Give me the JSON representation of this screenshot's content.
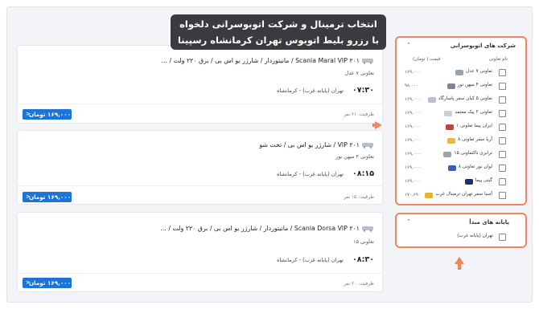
{
  "banner": {
    "line1": "انتخاب ترمینال و شرکت اتوبوسرانی دلخواه",
    "line2": "با رزرو بلیط اتوبوس تهران کرمانشاه رسپینا"
  },
  "trips": [
    {
      "title": "۲۰۱ Scania Maral VIP / مانیتوردار / شارژر یو اس بی / برق ۲۲۰ ولت / ...",
      "company": "تعاونی ۷ عدل",
      "time": "۰۷:۳۰",
      "route": "تهران (پایانه غرب) - کرمانشاه",
      "capacity": "ظرفیت: ۲۱ نفر",
      "price": "۱۶۹,۰۰۰ تومان"
    },
    {
      "title": "۲۰۱ VIP / شارژر یو اس بی / تخت شو",
      "company": "تعاونی ۴ میهن نور",
      "time": "۰۸:۱۵",
      "route": "تهران (پایانه غرب) - کرمانشاه",
      "capacity": "ظرفیت: ۱۵ نفر",
      "price": "۱۶۹,۰۰۰ تومان"
    },
    {
      "title": "۲۰۱ Scania Dorsa VIP / مانیتوردار / شارژر یو اس بی / برق ۲۲۰ ولت / ...",
      "company": "تعاونی ۱۵",
      "time": "۰۸:۳۰",
      "route": "تهران (پایانه غرب) - کرمانشاه",
      "capacity": "ظرفیت: ۲۰ نفر",
      "price": "۱۶۹,۰۰۰ تومان"
    }
  ],
  "operators_panel": {
    "title": "شرکت های اتوبوسرانی",
    "col_name": "نام تعاونی",
    "col_price": "قیمت ( تومان)",
    "items": [
      {
        "name": "تعاونی ۷ عدل",
        "price": "۱۶۹,۰۰۰",
        "logo_color": "#9aa3b0"
      },
      {
        "name": "تعاونی ۴ میهن نور",
        "price": "۹۸,۰۰۰",
        "logo_color": "#7d8794"
      },
      {
        "name": "تعاونی ۵ کیان سفر پاسارگاد",
        "price": "۱۶۹,۰۰۰",
        "logo_color": "#b8c0cc"
      },
      {
        "name": "تعاونی ۲ پیک معتمد",
        "price": "۱۶۹,۰۰۰",
        "logo_color": "#c9cfd8"
      },
      {
        "name": "ایران پیما تعاونی ۱",
        "price": "۱۶۹,۰۰۰",
        "logo_color": "#d63a3a"
      },
      {
        "name": "آریا سفر تعاونی ۸",
        "price": "۱۶۹,۰۰۰",
        "logo_color": "#e8b84a"
      },
      {
        "name": "ترابری تاکتفاونی ۱۵",
        "price": "۱۶۹,۰۰۰",
        "logo_color": "#9aa3b0"
      },
      {
        "name": "لوان نور تعاونی ۸",
        "price": "۱۶۹,۰۰۰",
        "logo_color": "#3a5fb0"
      },
      {
        "name": "گیتی پیما",
        "price": "۱۶۹,۰۰۰",
        "logo_color": "#1f2f6e"
      },
      {
        "name": "آسیا سفر تهران ترمینال غرب",
        "price": "۱۷۰,۶۹۰",
        "logo_color": "#e2b62c"
      }
    ]
  },
  "origin_panel": {
    "title": "پایانه های مبدأ",
    "items": [
      {
        "name": "تهران (پایانه غرب)"
      }
    ]
  },
  "colors": {
    "accent": "#f0855f",
    "price_button": "#1b74d6",
    "banner_bg": "#3a3b3e"
  }
}
